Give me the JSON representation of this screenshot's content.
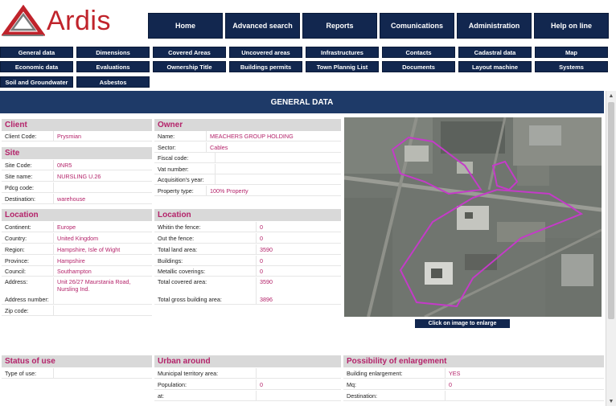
{
  "brand": {
    "name": "Ardis",
    "logo_color": "#c0232b"
  },
  "mainnav": [
    "Home",
    "Advanced search",
    "Reports",
    "Comunications",
    "Administration",
    "Help on line"
  ],
  "subnav": {
    "row1": [
      "General data",
      "Dimensions",
      "Covered Areas",
      "Uncovered areas",
      "Infrastructures",
      "Contacts",
      "Cadastral data",
      "Map"
    ],
    "row2": [
      "Economic data",
      "Evaluations",
      "Ownership Title",
      "Buildings permits",
      "Town Plannig List",
      "Documents",
      "Layout machine",
      "Systems"
    ],
    "row3": [
      "Soil and Groundwater",
      "Asbestos"
    ]
  },
  "section_title": "GENERAL DATA",
  "client": {
    "header": "Client",
    "rows": [
      {
        "label": "Client Code:",
        "value": "Prysmian"
      }
    ]
  },
  "site": {
    "header": "Site",
    "rows": [
      {
        "label": "Site Code:",
        "value": "0NR5"
      },
      {
        "label": "Site name:",
        "value": "NURSLING U.26"
      },
      {
        "label": "Pdcg code:",
        "value": ""
      },
      {
        "label": "Destination:",
        "value": "warehouse"
      }
    ]
  },
  "owner": {
    "header": "Owner",
    "rows": [
      {
        "label": "Name:",
        "value": "MEACHERS GROUP HOLDING"
      },
      {
        "label": "Sector:",
        "value": "Cables"
      },
      {
        "label": "Fiscal code:",
        "value": ""
      },
      {
        "label": "Vat number:",
        "value": ""
      },
      {
        "label": "Acquisition's year:",
        "value": ""
      },
      {
        "label": "Property type:",
        "value": "100% Property"
      }
    ]
  },
  "location_left": {
    "header": "Location",
    "rows": [
      {
        "label": "Continent:",
        "value": "Europe"
      },
      {
        "label": "Country:",
        "value": "United Kingdom"
      },
      {
        "label": "Region:",
        "value": "Hampshire, Isle of Wight"
      },
      {
        "label": "Province:",
        "value": "Hampshire"
      },
      {
        "label": "Council:",
        "value": "Southampton"
      },
      {
        "label": "Address:",
        "value": "Unit 26/27 Maurstania Road, Nursling Ind."
      },
      {
        "label": "Address number:",
        "value": ""
      },
      {
        "label": "Zip code:",
        "value": ""
      }
    ]
  },
  "location_right": {
    "header": "Location",
    "rows": [
      {
        "label": "Whitin the fence:",
        "value": "0"
      },
      {
        "label": "Out the fence:",
        "value": "0"
      },
      {
        "label": "Total land area:",
        "value": "3590"
      },
      {
        "label": "Buildings:",
        "value": "0"
      },
      {
        "label": "Metallic coverings:",
        "value": "0"
      },
      {
        "label": "Total covered area:",
        "value": "3590"
      },
      {
        "label": "Total gross building area:",
        "value": "3896"
      }
    ]
  },
  "map": {
    "enlarge_label": "Click on image to enlarge"
  },
  "status_of_use": {
    "header": "Status of use",
    "rows": [
      {
        "label": "Type of use:",
        "value": ""
      }
    ]
  },
  "urban_around": {
    "header": "Urban around",
    "rows": [
      {
        "label": "Municipal territory area:",
        "value": ""
      },
      {
        "label": "Population:",
        "value": "0"
      },
      {
        "label": "at:",
        "value": ""
      }
    ]
  },
  "enlargement": {
    "header": "Possibility of enlargement",
    "rows": [
      {
        "label": "Building enlargement:",
        "value": "YES"
      },
      {
        "label": "Mq:",
        "value": "0"
      },
      {
        "label": "Destination:",
        "value": ""
      }
    ]
  }
}
